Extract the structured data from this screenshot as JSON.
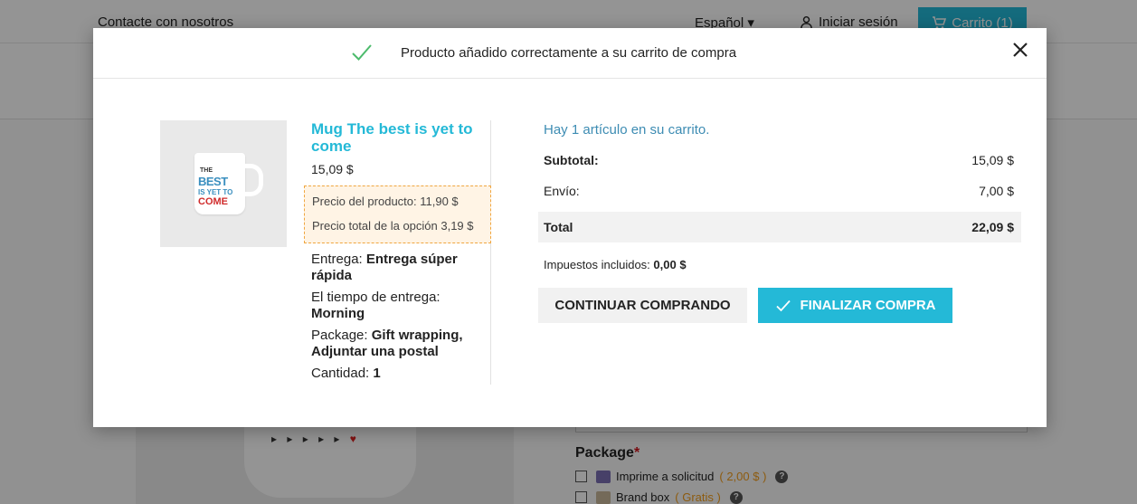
{
  "topbar": {
    "contact_label": "Contacte con nosotros",
    "language_label": "Español ▾",
    "signin_label": "Iniciar sesión",
    "cart_label": "Carrito (1)"
  },
  "modal": {
    "title": "Producto añadido correctamente a su carrito de compra",
    "product": {
      "name": "Mug The best is yet to come",
      "price": "15,09 $",
      "option_product_price": "Precio del producto: 11,90 $",
      "option_total_price": "Precio total de la opción 3,19 $",
      "attributes": [
        {
          "label": "Entrega: ",
          "value": "Entrega súper rápida"
        },
        {
          "label": "El tiempo de entrega: ",
          "value": "Morning"
        },
        {
          "label": "Package: ",
          "value": "Gift wrapping, Adjuntar una postal"
        },
        {
          "label": "Cantidad: ",
          "value": "1"
        }
      ],
      "image_text": [
        "THE",
        "BEST",
        "IS YET TO",
        "COME"
      ]
    },
    "cart": {
      "count_text": "Hay 1 artículo en su carrito.",
      "subtotal_label": "Subtotal:",
      "subtotal_value": "15,09 $",
      "shipping_label": "Envío:",
      "shipping_value": "7,00 $",
      "total_label": "Total",
      "total_value": "22,09 $",
      "tax_label": "Impuestos incluidos: ",
      "tax_value": "0,00 $",
      "continue_label": "CONTINUAR COMPRANDO",
      "checkout_label": "FINALIZAR COMPRA"
    }
  },
  "background": {
    "package_title": "Package",
    "required_mark": "*",
    "package_options": [
      {
        "label": "Imprime a solicitud",
        "price": "( 2,00 $ )"
      },
      {
        "label": "Brand box",
        "price": "( Gratis )"
      }
    ]
  },
  "colors": {
    "accent": "#24b9d7",
    "check_green": "#4cbb6c",
    "option_border": "#f0a640"
  }
}
